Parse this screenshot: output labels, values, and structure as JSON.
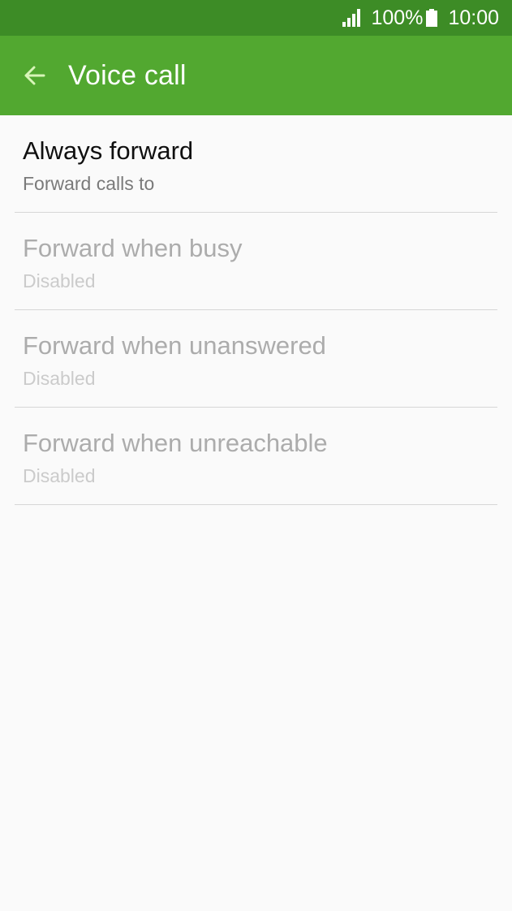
{
  "status_bar": {
    "battery_percent": "100%",
    "time": "10:00",
    "icons": [
      "signal-icon",
      "battery-icon"
    ]
  },
  "app_bar": {
    "title": "Voice call",
    "back_icon": "arrow-left-icon",
    "background_color": "#52a830",
    "status_color": "#3d8c26"
  },
  "settings": {
    "items": [
      {
        "title": "Always forward",
        "summary": "Forward calls to",
        "enabled": true
      },
      {
        "title": "Forward when busy",
        "summary": "Disabled",
        "enabled": false
      },
      {
        "title": "Forward when unanswered",
        "summary": "Disabled",
        "enabled": false
      },
      {
        "title": "Forward when unreachable",
        "summary": "Disabled",
        "enabled": false
      }
    ]
  }
}
